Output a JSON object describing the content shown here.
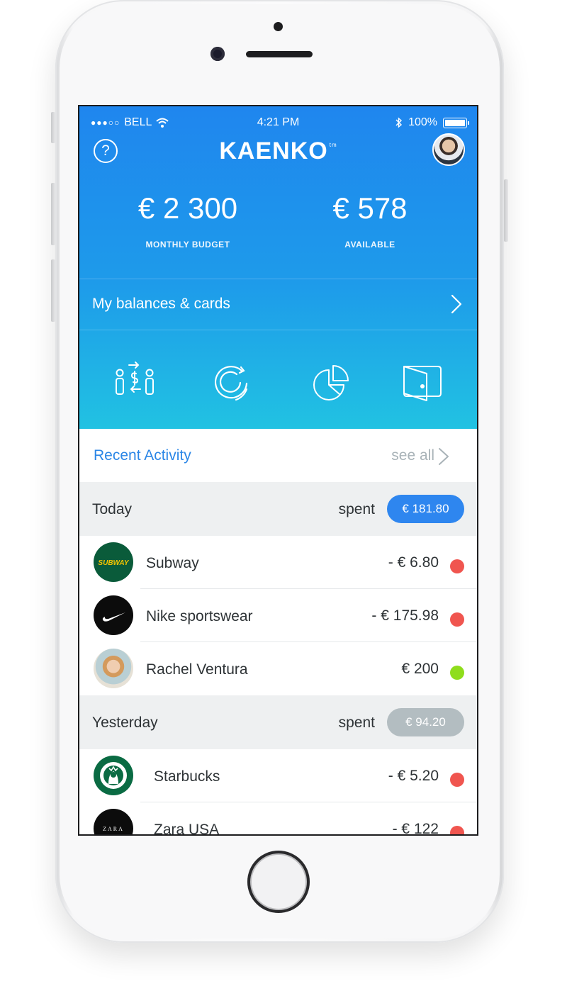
{
  "status_bar": {
    "carrier_dots": "●●●○○",
    "carrier": "BELL",
    "time": "4:21 PM",
    "battery": "100%"
  },
  "header": {
    "logo": "KAENKO",
    "logo_tm": "tm",
    "help": "?",
    "budget": {
      "amount": "€ 2 300",
      "label": "MONTHLY BUDGET"
    },
    "available": {
      "amount": "€ 578",
      "label": "AVAILABLE"
    },
    "balances_link": "My balances & cards",
    "quick_actions": [
      "transfer-icon",
      "cycle-icon",
      "pie-chart-icon",
      "wallet-icon"
    ]
  },
  "recent": {
    "title": "Recent Activity",
    "see_all": "see all"
  },
  "days": [
    {
      "name": "Today",
      "spent_label": "spent",
      "total": "€ 181.80",
      "pill_color": "#2e86ef",
      "transactions": [
        {
          "name": "Subway",
          "amount": "- € 6.80",
          "status_color": "#f0554f",
          "logo_text": "SUBWAY"
        },
        {
          "name": "Nike sportswear",
          "amount": "- € 175.98",
          "status_color": "#f0554f",
          "logo_text": ""
        },
        {
          "name": "Rachel Ventura",
          "amount": "€ 200",
          "status_color": "#8fdd1c",
          "logo_text": ""
        }
      ]
    },
    {
      "name": "Yesterday",
      "spent_label": "spent",
      "total": "€ 94.20",
      "pill_color": "#b3bdc1",
      "transactions": [
        {
          "name": "Starbucks",
          "amount": "- € 5.20",
          "status_color": "#f0554f",
          "logo_text": ""
        },
        {
          "name": "Zara USA",
          "amount": "- € 122",
          "status_color": "#f0554f",
          "logo_text": "ZARA"
        }
      ]
    }
  ]
}
